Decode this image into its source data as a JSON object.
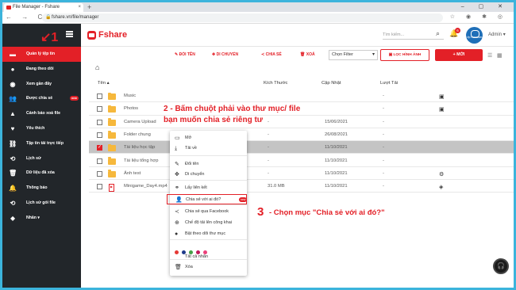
{
  "browser": {
    "tab_title": "File Manager - Fshare",
    "tab_close": "×",
    "new_tab": "+",
    "window_controls": "– ▢ ✕",
    "nav_buttons": "← → C",
    "url": "fshare.vn/file/manager",
    "lock": "🔒",
    "ext_icons": "☆ ◉ ✱ ◎"
  },
  "sidebar": {
    "items": [
      {
        "label": "Quản lý tệp tin",
        "icon": "folder-icon",
        "glyph": "▬",
        "active": true
      },
      {
        "label": "Đang theo dõi",
        "icon": "follow-icon",
        "glyph": "●"
      },
      {
        "label": "Xem gần đây",
        "icon": "eye-icon",
        "glyph": "◉"
      },
      {
        "label": "Được chia sẻ",
        "icon": "shared-users-icon",
        "glyph": "👥",
        "badge": "new"
      },
      {
        "label": "Cảnh báo xoá file",
        "icon": "warning-icon",
        "glyph": "▲"
      },
      {
        "label": "Yêu thích",
        "icon": "heart-icon",
        "glyph": "♥"
      },
      {
        "label": "Tập tin tải trực tiếp",
        "icon": "link-icon",
        "glyph": "⛓"
      },
      {
        "label": "Lịch sử",
        "icon": "history-icon",
        "glyph": "⟲"
      },
      {
        "label": "Dữ liệu đã xóa",
        "icon": "trash-icon",
        "glyph": "🗑"
      },
      {
        "label": "Thông báo",
        "icon": "bell-icon",
        "glyph": "🔔"
      },
      {
        "label": "Lịch sử gói file",
        "icon": "package-history-icon",
        "glyph": "⟲"
      },
      {
        "label": "Nhãn",
        "icon": "tag-icon",
        "glyph": "⬥",
        "chevron": "▾"
      }
    ]
  },
  "header": {
    "logo_text": "Fshare",
    "search_placeholder": "Tìm kiếm...",
    "notification_count": "6",
    "avatar_text": "Vip Premium",
    "user_label": "Admin",
    "user_chevron": "▾"
  },
  "toolbar": {
    "rename": "✎ ĐỔI TÊN",
    "move": "✥ DI CHUYỂN",
    "share": "≺ CHIA SẺ",
    "delete": "🗑 XOÁ",
    "filter": "Chọn Filter",
    "image_filter": "▣ LỌC HÌNH ẢNH",
    "new": "+ MỚI",
    "list_view": "☰",
    "grid_view": "▦"
  },
  "breadcrumb": {
    "home_icon": "⌂"
  },
  "table": {
    "headers": {
      "name": "Tên ▴",
      "size": "Kích Thước",
      "updated": "Cập Nhật",
      "downloads": "Lượt Tải"
    },
    "rows": [
      {
        "name": "Music",
        "size": "",
        "updated": "",
        "downloads": "-",
        "type": "folder",
        "icon": "▣"
      },
      {
        "name": "Photos",
        "size": "",
        "updated": "",
        "downloads": "-",
        "type": "folder",
        "icon": "▣"
      },
      {
        "name": "Camera Upload",
        "size": "-",
        "updated": "15/06/2021",
        "downloads": "-",
        "type": "folder",
        "icon": ""
      },
      {
        "name": "Folder chung",
        "size": "-",
        "updated": "26/08/2021",
        "downloads": "-",
        "type": "folder",
        "icon": ""
      },
      {
        "name": "Tài liệu học tập",
        "size": "-",
        "updated": "11/10/2021",
        "downloads": "-",
        "type": "folder",
        "icon": "",
        "selected": true
      },
      {
        "name": "Tài liệu tổng hợp",
        "size": "-",
        "updated": "11/10/2021",
        "downloads": "-",
        "type": "folder",
        "icon": ""
      },
      {
        "name": "Ảnh test",
        "size": "-",
        "updated": "11/10/2021",
        "downloads": "-",
        "type": "folder",
        "icon": "⚙"
      },
      {
        "name": "Minigame_Day4.mp4",
        "size": "31.0 MB",
        "updated": "11/10/2021",
        "downloads": "-",
        "type": "file",
        "icon": "◈"
      }
    ]
  },
  "context_menu": {
    "items": [
      {
        "label": "Mở",
        "icon": "open-icon",
        "glyph": "▭"
      },
      {
        "label": "Tải về",
        "icon": "download-icon",
        "glyph": "⤓"
      },
      {
        "label": "Đổi tên",
        "icon": "rename-icon",
        "glyph": "✎"
      },
      {
        "label": "Di chuyển",
        "icon": "move-icon",
        "glyph": "✥"
      },
      {
        "label": "Lấy liên kết",
        "icon": "link-icon",
        "glyph": "⚭"
      },
      {
        "label": "Chia sẻ với ai đó?",
        "icon": "share-person-icon",
        "glyph": "👤",
        "badge": "new",
        "highlight": true
      },
      {
        "label": "Chia sẻ qua Facebook",
        "icon": "share-icon",
        "glyph": "≺"
      },
      {
        "label": "Chế độ tải lên công khai",
        "icon": "public-upload-icon",
        "glyph": "⊕"
      },
      {
        "label": "Bật theo dõi thư mục",
        "icon": "follow-folder-icon",
        "glyph": "●"
      },
      {
        "label": "Tất cả nhãn",
        "icon": "",
        "glyph": ""
      },
      {
        "label": "Xóa",
        "icon": "delete-icon",
        "glyph": "🗑"
      }
    ],
    "label_colors": [
      "#e53935",
      "#1e3a8a",
      "#43a047",
      "#c2185b",
      "#ec407a"
    ]
  },
  "annotations": {
    "step1": "1",
    "step2_line1": "2 - Bấm chuột phải vào thư mục/ file",
    "step2_line2": "bạn muốn chia sẻ riêng tư",
    "step3_num": "3",
    "step3_text": "- Chọn mục \"Chia sẻ với ai đó?\""
  },
  "help_button": "🎧"
}
